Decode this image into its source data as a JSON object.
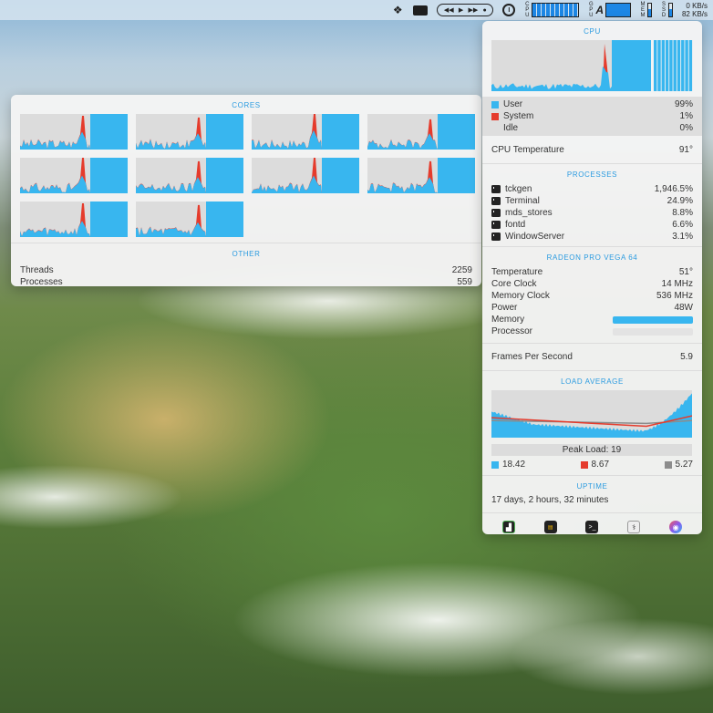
{
  "menubar": {
    "cpu_label": "C P U",
    "gpu_label": "G P U",
    "letter_a": "A",
    "mem_label": "M E M",
    "ssd_label": "S S D",
    "net_down": "0 KB/s",
    "net_up": "82 KB/s"
  },
  "cores_panel": {
    "title": "CORES",
    "cores": [
      {
        "peaks": [
          0.95,
          0.55
        ]
      },
      {
        "peaks": [
          0.9,
          0.5
        ]
      },
      {
        "peaks": [
          1.0,
          0.6
        ]
      },
      {
        "peaks": [
          0.85,
          0.5
        ]
      },
      {
        "peaks": [
          1.0,
          0.55
        ]
      },
      {
        "peaks": [
          0.9,
          0.5
        ]
      },
      {
        "peaks": [
          1.0,
          0.55
        ]
      },
      {
        "peaks": [
          0.9,
          0.5
        ]
      },
      {
        "peaks": [
          0.95,
          0.5
        ]
      },
      {
        "peaks": [
          0.9,
          0.45
        ]
      }
    ],
    "other_title": "OTHER",
    "threads_label": "Threads",
    "threads_value": "2259",
    "processes_label": "Processes",
    "processes_value": "559"
  },
  "cpu_panel": {
    "title": "CPU",
    "user_label": "User",
    "user_value": "99%",
    "system_label": "System",
    "system_value": "1%",
    "idle_label": "Idle",
    "idle_value": "0%",
    "temp_label": "CPU Temperature",
    "temp_value": "91°",
    "processes_title": "PROCESSES",
    "processes": [
      {
        "name": "tckgen",
        "value": "1,946.5%"
      },
      {
        "name": "Terminal",
        "value": "24.9%"
      },
      {
        "name": "mds_stores",
        "value": "8.8%"
      },
      {
        "name": "fontd",
        "value": "6.6%"
      },
      {
        "name": "WindowServer",
        "value": "3.1%"
      }
    ],
    "gpu_title": "RADEON PRO VEGA 64",
    "gpu_rows": [
      {
        "label": "Temperature",
        "value": "51°"
      },
      {
        "label": "Core Clock",
        "value": "14 MHz"
      },
      {
        "label": "Memory Clock",
        "value": "536 MHz"
      },
      {
        "label": "Power",
        "value": "48W"
      }
    ],
    "memory_label": "Memory",
    "memory_level": 1.0,
    "processor_label": "Processor",
    "processor_level": 0.0,
    "fps_label": "Frames Per Second",
    "fps_value": "5.9",
    "load_title": "LOAD AVERAGE",
    "peak_load": "Peak Load: 19",
    "load_1": "18.42",
    "load_5": "8.67",
    "load_15": "5.27",
    "uptime_title": "UPTIME",
    "uptime_value": "17 days, 2 hours, 32 minutes"
  },
  "colors": {
    "accent": "#2b9be0",
    "user": "#38b6ef",
    "system": "#e53b2c",
    "idle": "#dedede",
    "load_15": "#8c8c8c"
  }
}
